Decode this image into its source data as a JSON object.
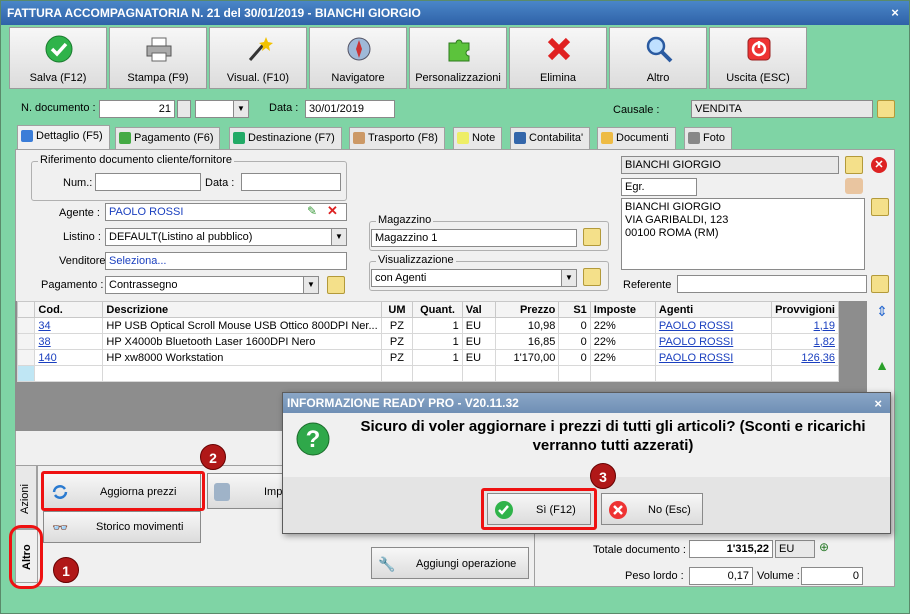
{
  "window": {
    "title": "FATTURA ACCOMPAGNATORIA N. 21 del 30/01/2019 - BIANCHI GIORGIO",
    "close": "×"
  },
  "toolbar": [
    {
      "label": "Salva (F12)",
      "icon": "check-icon"
    },
    {
      "label": "Stampa (F9)",
      "icon": "printer-icon"
    },
    {
      "label": "Visual. (F10)",
      "icon": "magic-wand-icon"
    },
    {
      "label": "Navigatore",
      "icon": "compass-icon"
    },
    {
      "label": "Personalizzazioni",
      "icon": "puzzle-icon"
    },
    {
      "label": "Elimina",
      "icon": "delete-x-icon"
    },
    {
      "label": "Altro",
      "icon": "search-icon"
    },
    {
      "label": "Uscita (ESC)",
      "icon": "exit-icon"
    }
  ],
  "header": {
    "ndoc_label": "N. documento :",
    "ndoc_value": "21",
    "data_label": "Data :",
    "data_value": "30/01/2019",
    "causale_label": "Causale :",
    "causale_value": "VENDITA"
  },
  "tabs": [
    "Dettaglio (F5)",
    "Pagamento (F6)",
    "Destinazione (F7)",
    "Trasporto (F8)",
    "Note",
    "Contabilita'",
    "Documenti",
    "Foto"
  ],
  "riferimento": {
    "title": "Riferimento documento cliente/fornitore",
    "num_label": "Num.:",
    "data_label": "Data :"
  },
  "form": {
    "agente_label": "Agente :",
    "agente_value": "PAOLO ROSSI",
    "listino_label": "Listino :",
    "listino_value": "DEFAULT(Listino al pubblico)",
    "venditore_label": "Venditore :",
    "venditore_value": "Seleziona...",
    "pagamento_label": "Pagamento :",
    "pagamento_value": "Contrassegno",
    "magazzino_title": "Magazzino",
    "magazzino_value": "Magazzino 1",
    "visualizzazione_title": "Visualizzazione",
    "visualizzazione_value": "con Agenti"
  },
  "customer": {
    "name": "BIANCHI GIORGIO",
    "title": "Egr.",
    "address": [
      "BIANCHI GIORGIO",
      "VIA GARIBALDI, 123",
      "00100 ROMA (RM)"
    ],
    "referente_label": "Referente"
  },
  "grid": {
    "columns": [
      "Cod.",
      "Descrizione",
      "UM",
      "Quant.",
      "Val",
      "Prezzo",
      "S1",
      "Imposte",
      "Agenti",
      "Provvigioni"
    ],
    "rows": [
      [
        "34",
        "HP USB Optical Scroll Mouse USB Ottico 800DPI Ner...",
        "PZ",
        "1",
        "EU",
        "10,98",
        "0",
        "22%",
        "PAOLO ROSSI",
        "1,19"
      ],
      [
        "38",
        "HP X4000b Bluetooth Laser 1600DPI Nero",
        "PZ",
        "1",
        "EU",
        "16,85",
        "0",
        "22%",
        "PAOLO ROSSI",
        "1,82"
      ],
      [
        "140",
        "HP xw8000 Workstation",
        "PZ",
        "1",
        "EU",
        "1'170,00",
        "0",
        "22%",
        "PAOLO ROSSI",
        "126,36"
      ]
    ]
  },
  "side_tabs": {
    "azioni": "Azioni",
    "altro": "Altro"
  },
  "actions": {
    "aggiorna": "Aggiorna prezzi",
    "storico": "Storico movimenti",
    "imp": "Imp",
    "aggiungi": "Aggiungi operazione"
  },
  "totals": {
    "totale_label": "Totale documento :",
    "totale_value": "1'315,22",
    "currency": "EU",
    "peso_label": "Peso lordo :",
    "peso_value": "0,17",
    "volume_label": "Volume :",
    "volume_value": "0"
  },
  "dialog": {
    "title": "INFORMAZIONE READY PRO - V20.11.32",
    "message_line1": "Sicuro di voler aggiornare i prezzi di tutti gli articoli? (Sconti e ricarichi",
    "message_line2": "verranno tutti azzerati)",
    "yes_label": "Sì (F12)",
    "no_label": "No (Esc)",
    "close": "×"
  },
  "badges": [
    "1",
    "2",
    "3"
  ],
  "colors": {
    "window_bg": "#7fd4a5",
    "highlight": "#e11111",
    "badge": "#b01818",
    "link": "#1a3fbf"
  }
}
